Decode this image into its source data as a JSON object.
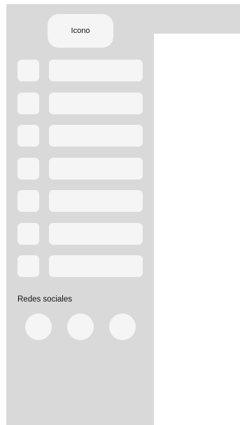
{
  "logo": {
    "label": "Icono"
  },
  "nav": {
    "items": [
      {
        "icon": "placeholder-icon",
        "label": ""
      },
      {
        "icon": "placeholder-icon",
        "label": ""
      },
      {
        "icon": "placeholder-icon",
        "label": ""
      },
      {
        "icon": "placeholder-icon",
        "label": ""
      },
      {
        "icon": "placeholder-icon",
        "label": ""
      },
      {
        "icon": "placeholder-icon",
        "label": ""
      },
      {
        "icon": "placeholder-icon",
        "label": ""
      }
    ]
  },
  "social": {
    "title": "Redes sociales",
    "items": [
      {
        "icon": "social-icon"
      },
      {
        "icon": "social-icon"
      },
      {
        "icon": "social-icon"
      }
    ]
  },
  "colors": {
    "panel": "#d9d9d9",
    "placeholder": "#f5f5f5",
    "text": "#111111",
    "background": "#ffffff"
  }
}
